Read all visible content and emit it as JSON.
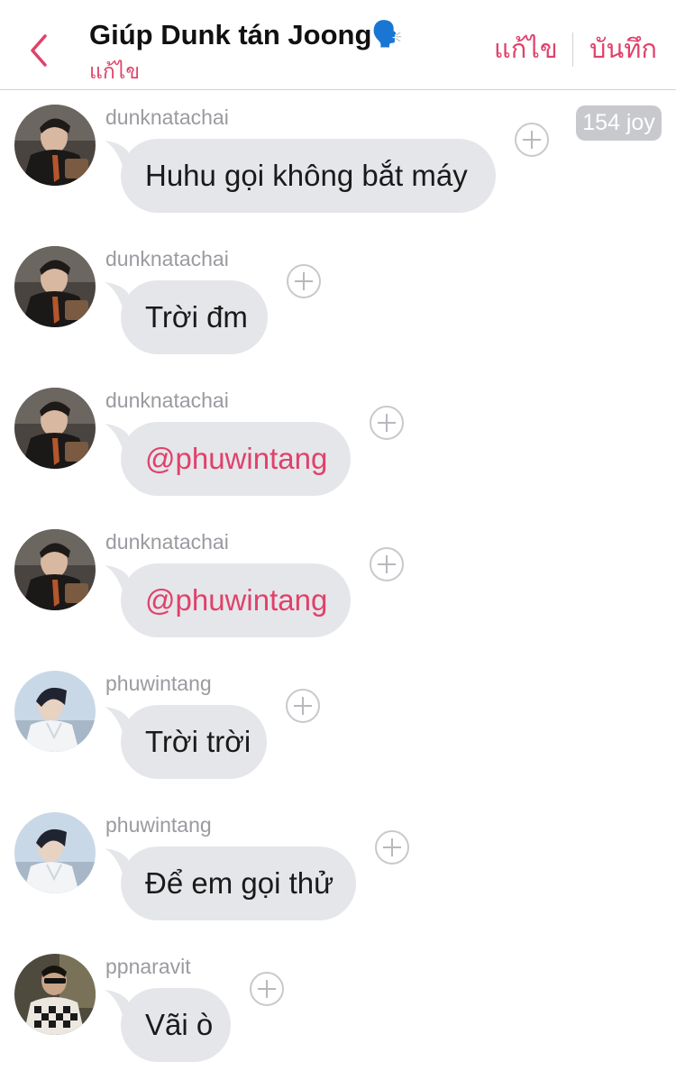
{
  "header": {
    "title": "Giúp Dunk tán Joong",
    "title_emoji": "🗣️",
    "subtitle": "แก้ไข",
    "edit_label": "แก้ไข",
    "save_label": "บันทึก"
  },
  "joy_badge": "154 joy",
  "colors": {
    "accent": "#e0416a",
    "bubble": "#e5e6ea",
    "username": "#9a9aa0"
  },
  "messages": [
    {
      "user": "dunknatachai",
      "text": "Huhu gọi không bắt máy",
      "mention": false,
      "avatar": "dunk"
    },
    {
      "user": "dunknatachai",
      "text": "Trời đm",
      "mention": false,
      "avatar": "dunk"
    },
    {
      "user": "dunknatachai",
      "text": "@phuwintang",
      "mention": true,
      "avatar": "dunk"
    },
    {
      "user": "dunknatachai",
      "text": "@phuwintang",
      "mention": true,
      "avatar": "dunk"
    },
    {
      "user": "phuwintang",
      "text": "Trời trời",
      "mention": false,
      "avatar": "phuwin"
    },
    {
      "user": "phuwintang",
      "text": "Để em gọi thử",
      "mention": false,
      "avatar": "phuwin"
    },
    {
      "user": "ppnaravit",
      "text": "Vãi ò",
      "mention": false,
      "avatar": "pp"
    }
  ]
}
